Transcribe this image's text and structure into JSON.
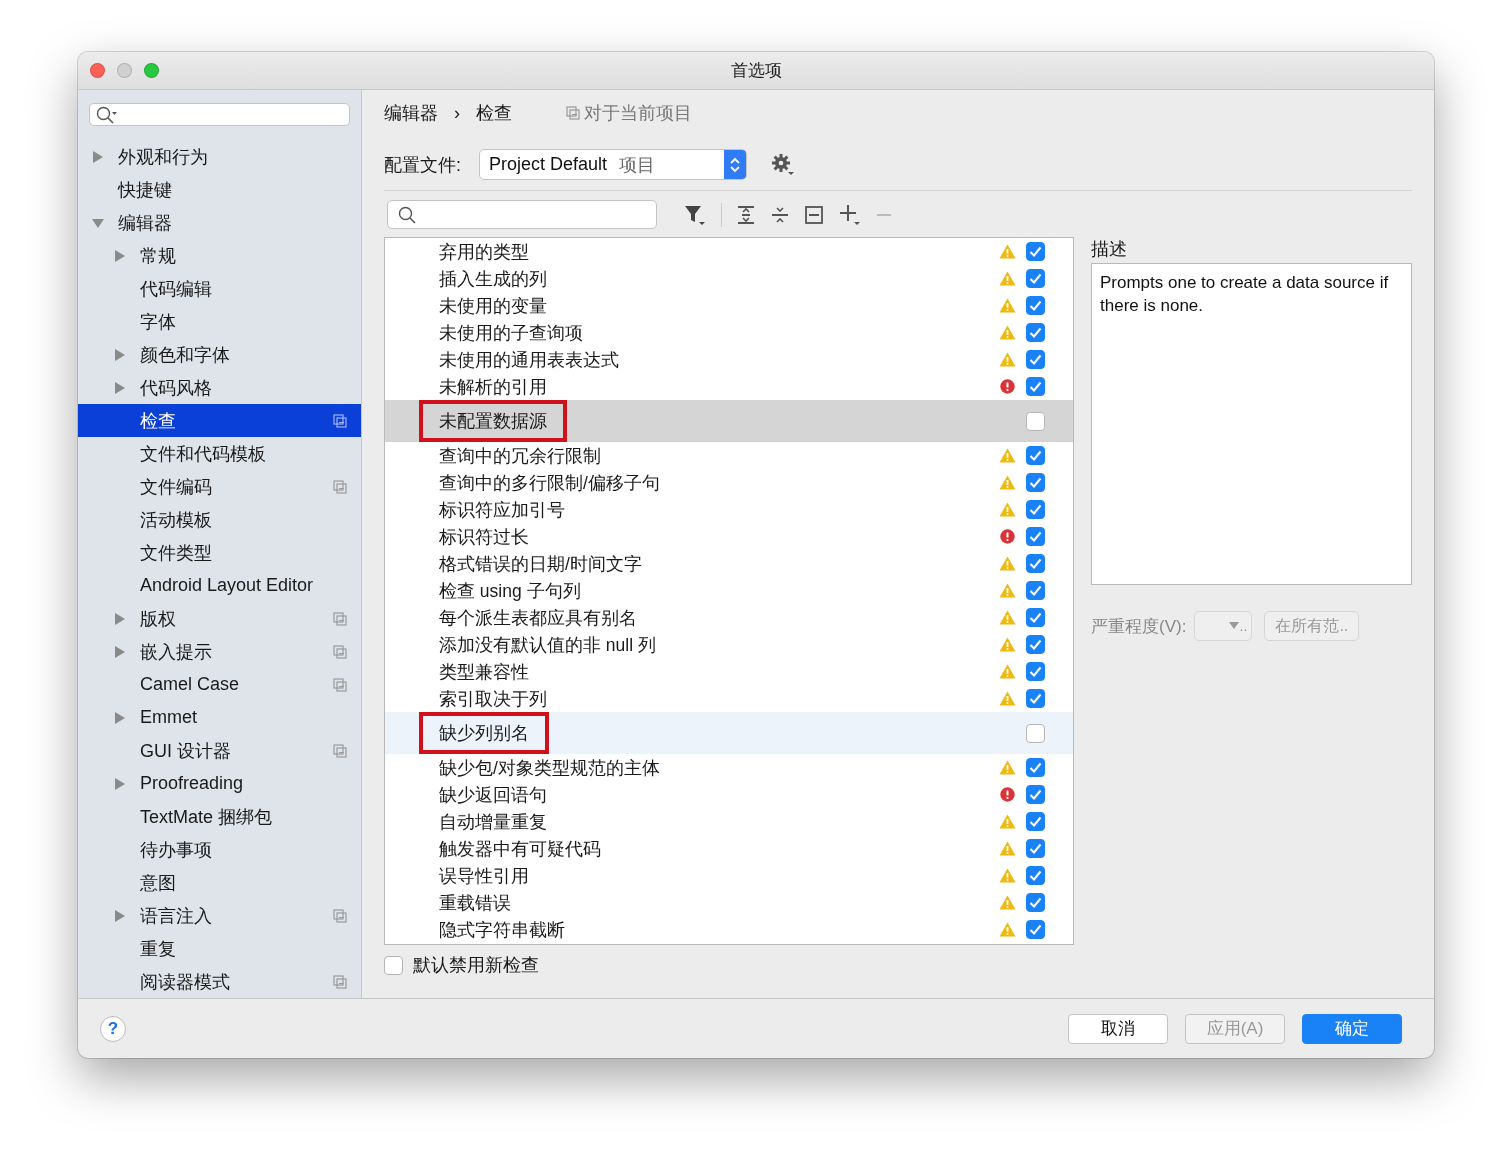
{
  "window": {
    "title": "首选项"
  },
  "sidebar": {
    "items": [
      {
        "label": "外观和行为",
        "expanded": false,
        "selected": false,
        "project_scope": false
      },
      {
        "label": "快捷键",
        "selected": false,
        "project_scope": false
      },
      {
        "label": "编辑器",
        "expanded": true,
        "selected": false,
        "project_scope": false,
        "children": [
          {
            "label": "常规",
            "expanded": false,
            "selected": false,
            "project_scope": false
          },
          {
            "label": "代码编辑",
            "selected": false,
            "project_scope": false
          },
          {
            "label": "字体",
            "selected": false,
            "project_scope": false
          },
          {
            "label": "颜色和字体",
            "expanded": false,
            "selected": false,
            "project_scope": false
          },
          {
            "label": "代码风格",
            "expanded": false,
            "selected": false,
            "project_scope": false
          },
          {
            "label": "检查",
            "selected": true,
            "project_scope": true
          },
          {
            "label": "文件和代码模板",
            "selected": false,
            "project_scope": false
          },
          {
            "label": "文件编码",
            "selected": false,
            "project_scope": true
          },
          {
            "label": "活动模板",
            "selected": false,
            "project_scope": false
          },
          {
            "label": "文件类型",
            "selected": false,
            "project_scope": false
          },
          {
            "label": "Android Layout Editor",
            "selected": false,
            "project_scope": false
          },
          {
            "label": "版权",
            "expanded": false,
            "selected": false,
            "project_scope": true
          },
          {
            "label": "嵌入提示",
            "expanded": false,
            "selected": false,
            "project_scope": true
          },
          {
            "label": "Camel Case",
            "selected": false,
            "project_scope": true
          },
          {
            "label": "Emmet",
            "expanded": false,
            "selected": false,
            "project_scope": false
          },
          {
            "label": "GUI 设计器",
            "selected": false,
            "project_scope": true
          },
          {
            "label": "Proofreading",
            "expanded": false,
            "selected": false,
            "project_scope": false
          },
          {
            "label": "TextMate 捆绑包",
            "selected": false,
            "project_scope": false
          },
          {
            "label": "待办事项",
            "selected": false,
            "project_scope": false
          },
          {
            "label": "意图",
            "selected": false,
            "project_scope": false
          },
          {
            "label": "语言注入",
            "expanded": false,
            "selected": false,
            "project_scope": true
          },
          {
            "label": "重复",
            "selected": false,
            "project_scope": false
          },
          {
            "label": "阅读器模式",
            "selected": false,
            "project_scope": true
          }
        ]
      }
    ]
  },
  "breadcrumb": {
    "items": [
      "编辑器",
      "检查"
    ],
    "separator": "›",
    "scope": "对于当前项目"
  },
  "profile": {
    "label": "配置文件:",
    "value": "Project Default",
    "suffix": "项目"
  },
  "inspections": [
    {
      "label": "弃用的类型",
      "kind": "warning",
      "checked": true,
      "selected": false,
      "hovered": false,
      "annotated": false
    },
    {
      "label": "插入生成的列",
      "kind": "warning",
      "checked": true,
      "selected": false,
      "hovered": false,
      "annotated": false
    },
    {
      "label": "未使用的变量",
      "kind": "warning",
      "checked": true,
      "selected": false,
      "hovered": false,
      "annotated": false
    },
    {
      "label": "未使用的子查询项",
      "kind": "warning",
      "checked": true,
      "selected": false,
      "hovered": false,
      "annotated": false
    },
    {
      "label": "未使用的通用表表达式",
      "kind": "warning",
      "checked": true,
      "selected": false,
      "hovered": false,
      "annotated": false
    },
    {
      "label": "未解析的引用",
      "kind": "error",
      "checked": true,
      "selected": false,
      "hovered": false,
      "annotated": false
    },
    {
      "label": "未配置数据源",
      "kind": "plain",
      "checked": false,
      "selected": true,
      "hovered": false,
      "annotated": true
    },
    {
      "label": "查询中的冗余行限制",
      "kind": "warning",
      "checked": true,
      "selected": false,
      "hovered": false,
      "annotated": false
    },
    {
      "label": "查询中的多行限制/偏移子句",
      "kind": "warning",
      "checked": true,
      "selected": false,
      "hovered": false,
      "annotated": false
    },
    {
      "label": "标识符应加引号",
      "kind": "warning",
      "checked": true,
      "selected": false,
      "hovered": false,
      "annotated": false
    },
    {
      "label": "标识符过长",
      "kind": "error",
      "checked": true,
      "selected": false,
      "hovered": false,
      "annotated": false
    },
    {
      "label": "格式错误的日期/时间文字",
      "kind": "warning",
      "checked": true,
      "selected": false,
      "hovered": false,
      "annotated": false
    },
    {
      "label": "检查 using 子句列",
      "kind": "warning",
      "checked": true,
      "selected": false,
      "hovered": false,
      "annotated": false
    },
    {
      "label": "每个派生表都应具有别名",
      "kind": "warning",
      "checked": true,
      "selected": false,
      "hovered": false,
      "annotated": false
    },
    {
      "label": "添加没有默认值的非 null 列",
      "kind": "warning",
      "checked": true,
      "selected": false,
      "hovered": false,
      "annotated": false
    },
    {
      "label": "类型兼容性",
      "kind": "warning",
      "checked": true,
      "selected": false,
      "hovered": false,
      "annotated": false
    },
    {
      "label": "索引取决于列",
      "kind": "warning",
      "checked": true,
      "selected": false,
      "hovered": false,
      "annotated": false
    },
    {
      "label": "缺少列别名",
      "kind": "plain",
      "checked": false,
      "selected": false,
      "hovered": true,
      "annotated": true
    },
    {
      "label": "缺少包/对象类型规范的主体",
      "kind": "warning",
      "checked": true,
      "selected": false,
      "hovered": false,
      "annotated": false
    },
    {
      "label": "缺少返回语句",
      "kind": "error",
      "checked": true,
      "selected": false,
      "hovered": false,
      "annotated": false
    },
    {
      "label": "自动增量重复",
      "kind": "warning",
      "checked": true,
      "selected": false,
      "hovered": false,
      "annotated": false
    },
    {
      "label": "触发器中有可疑代码",
      "kind": "warning",
      "checked": true,
      "selected": false,
      "hovered": false,
      "annotated": false
    },
    {
      "label": "误导性引用",
      "kind": "warning",
      "checked": true,
      "selected": false,
      "hovered": false,
      "annotated": false
    },
    {
      "label": "重载错误",
      "kind": "warning",
      "checked": true,
      "selected": false,
      "hovered": false,
      "annotated": false
    },
    {
      "label": "隐式字符串截断",
      "kind": "warning",
      "checked": true,
      "selected": false,
      "hovered": false,
      "annotated": false
    }
  ],
  "disable_new": {
    "label": "默认禁用新检查",
    "checked": false
  },
  "description": {
    "title": "描述",
    "text": "Prompts one to create a data source if there is none."
  },
  "severity": {
    "label": "严重程度(V):",
    "value": "..",
    "scope_button": "在所有范.."
  },
  "buttons": [
    {
      "label": "取消",
      "kind": "normal"
    },
    {
      "label": "应用(A)",
      "kind": "disabled"
    },
    {
      "label": "确定",
      "kind": "primary"
    }
  ],
  "help": {
    "label": "?"
  }
}
